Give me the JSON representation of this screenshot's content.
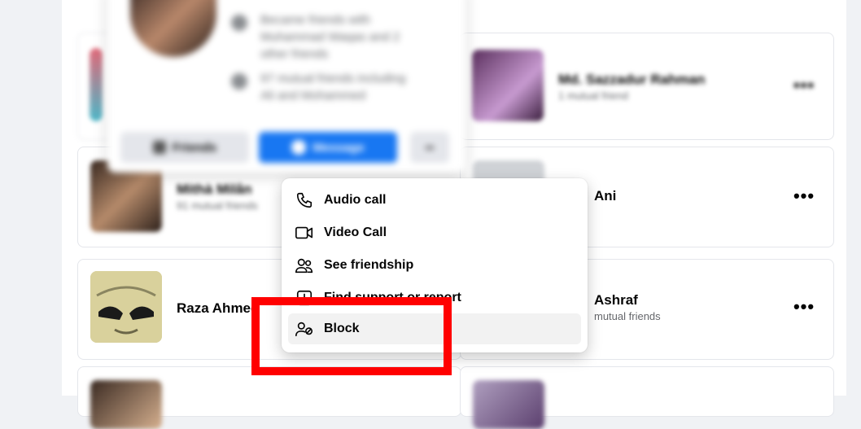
{
  "hovercard": {
    "info_line_1": "Became friends with Muhammad Waqas and 2 other friends",
    "info_line_2": "97 mutual friends including Ali and Mohammed",
    "friends_label": "Friends",
    "message_label": "Message"
  },
  "friends": [
    {
      "name": "Md. Sazzadur Rahman",
      "mutual": "1 mutual friend"
    },
    {
      "name": "Mithà Milân",
      "mutual": "91 mutual friends"
    },
    {
      "name": "Ani",
      "mutual": ""
    },
    {
      "name": "Raza Ahmed",
      "mutual": ""
    },
    {
      "name": "Ashraf",
      "mutual": "mutual friends"
    }
  ],
  "menu": {
    "items": [
      {
        "label": "Audio call",
        "icon": "phone-icon"
      },
      {
        "label": "Video Call",
        "icon": "video-camera-icon"
      },
      {
        "label": "See friendship",
        "icon": "friendship-icon"
      },
      {
        "label": "Find support or report",
        "icon": "report-icon"
      },
      {
        "label": "Block",
        "icon": "block-user-icon"
      }
    ]
  },
  "more_options_glyph": "•••",
  "colors": {
    "accent_blue": "#1877f2",
    "highlight_red": "#ff0000",
    "page_bg": "#f0f2f5"
  }
}
